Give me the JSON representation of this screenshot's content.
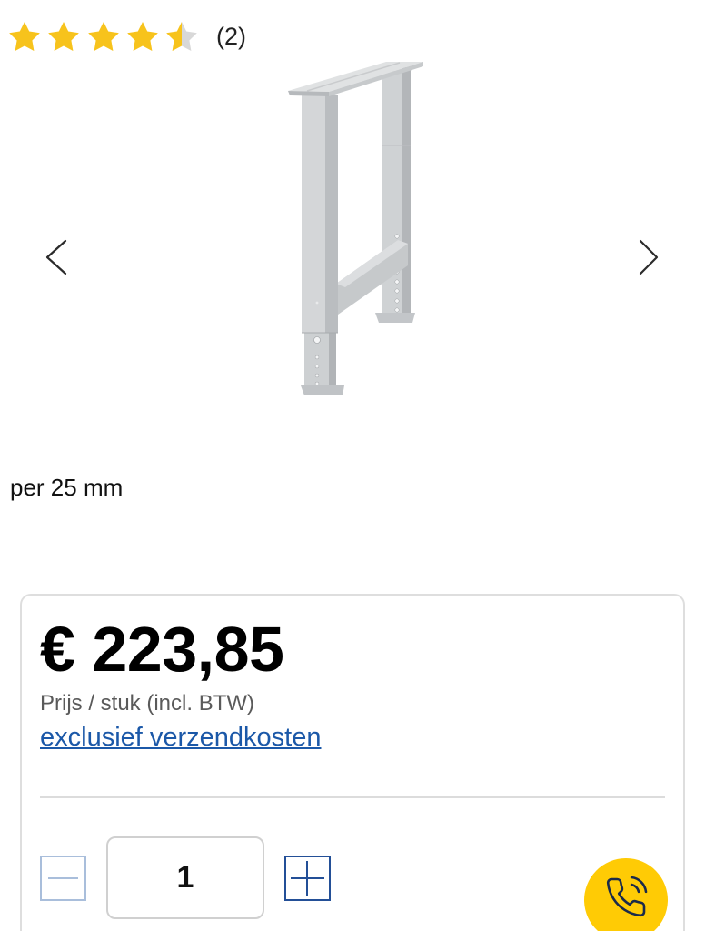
{
  "rating": {
    "stars": 4.5,
    "max": 5,
    "count_label": "(2)",
    "star_icon": "star-icon"
  },
  "gallery": {
    "prev_icon": "chevron-left-icon",
    "next_icon": "chevron-right-icon"
  },
  "feature_text": "per 25 mm",
  "purchase": {
    "price": "€ 223,85",
    "price_unit": "Prijs / stuk (incl. BTW)",
    "shipping_link": "exclusief verzendkosten",
    "quantity": "1",
    "decrease_icon": "minus-icon",
    "increase_icon": "plus-icon",
    "call_icon": "phone-call-icon"
  },
  "colors": {
    "star_filled": "#F7C31C",
    "star_empty": "#D8D8D8",
    "link_blue": "#1B58A8",
    "accent_blue": "#234F97",
    "disabled_blue": "#A9BEDB",
    "call_yellow": "#FFCB05",
    "icon_navy": "#1B2A4A"
  }
}
